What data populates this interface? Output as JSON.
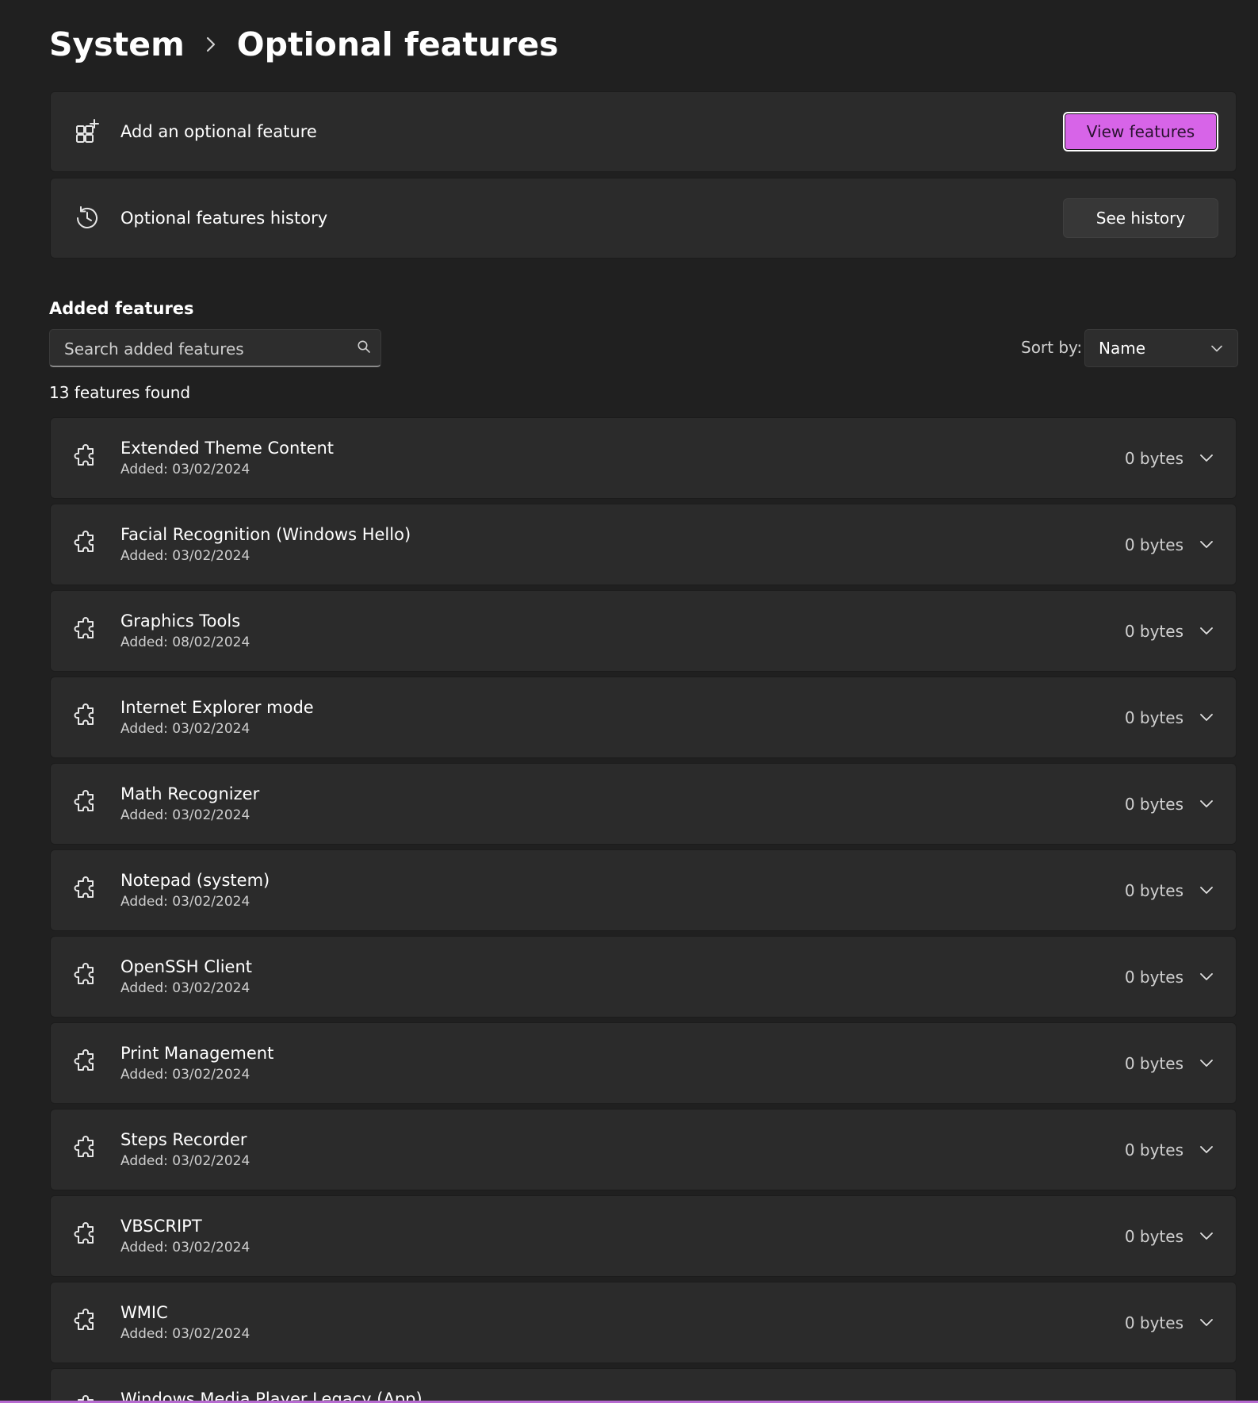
{
  "breadcrumb": {
    "parent": "System",
    "current": "Optional features"
  },
  "add_feature": {
    "label": "Add an optional feature",
    "button": "View features",
    "icon": "add-app-icon"
  },
  "history": {
    "label": "Optional features history",
    "button": "See history",
    "icon": "history-icon"
  },
  "added": {
    "section_title": "Added features",
    "search_placeholder": "Search added features",
    "sort_label": "Sort by:",
    "sort_value": "Name",
    "found_text": "13 features found"
  },
  "colors": {
    "accent": "#d764e8",
    "background": "#202020",
    "card": "#2b2b2b"
  },
  "features": [
    {
      "name": "Extended Theme Content",
      "added": "Added: 03/02/2024",
      "size": "0 bytes"
    },
    {
      "name": "Facial Recognition (Windows Hello)",
      "added": "Added: 03/02/2024",
      "size": "0 bytes"
    },
    {
      "name": "Graphics Tools",
      "added": "Added: 08/02/2024",
      "size": "0 bytes"
    },
    {
      "name": "Internet Explorer mode",
      "added": "Added: 03/02/2024",
      "size": "0 bytes"
    },
    {
      "name": "Math Recognizer",
      "added": "Added: 03/02/2024",
      "size": "0 bytes"
    },
    {
      "name": "Notepad (system)",
      "added": "Added: 03/02/2024",
      "size": "0 bytes"
    },
    {
      "name": "OpenSSH Client",
      "added": "Added: 03/02/2024",
      "size": "0 bytes"
    },
    {
      "name": "Print Management",
      "added": "Added: 03/02/2024",
      "size": "0 bytes"
    },
    {
      "name": "Steps Recorder",
      "added": "Added: 03/02/2024",
      "size": "0 bytes"
    },
    {
      "name": "VBSCRIPT",
      "added": "Added: 03/02/2024",
      "size": "0 bytes"
    },
    {
      "name": "WMIC",
      "added": "Added: 03/02/2024",
      "size": "0 bytes"
    },
    {
      "name": "Windows Media Player Legacy (App)",
      "added": "",
      "size": ""
    }
  ]
}
